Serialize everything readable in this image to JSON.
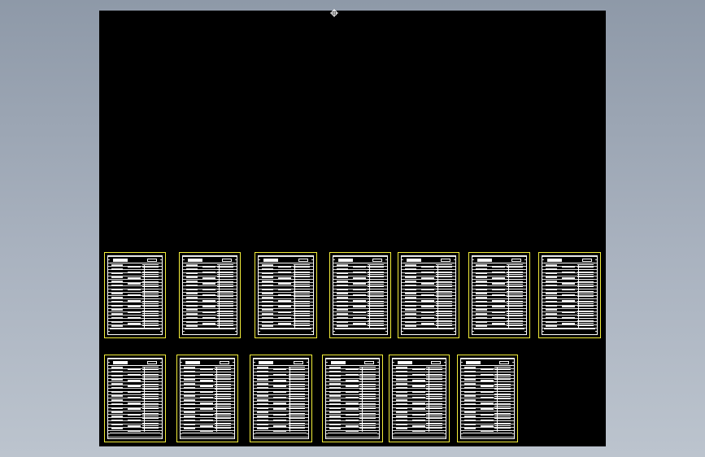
{
  "workspace": {
    "background": "#000000",
    "sheet_border_color": "#f5ef3a",
    "sheet_line_color": "#ffffff",
    "rows": [
      {
        "sheets": 7
      },
      {
        "sheets": 6
      }
    ]
  },
  "cursor": {
    "icon": "crosshair-cursor-icon"
  }
}
